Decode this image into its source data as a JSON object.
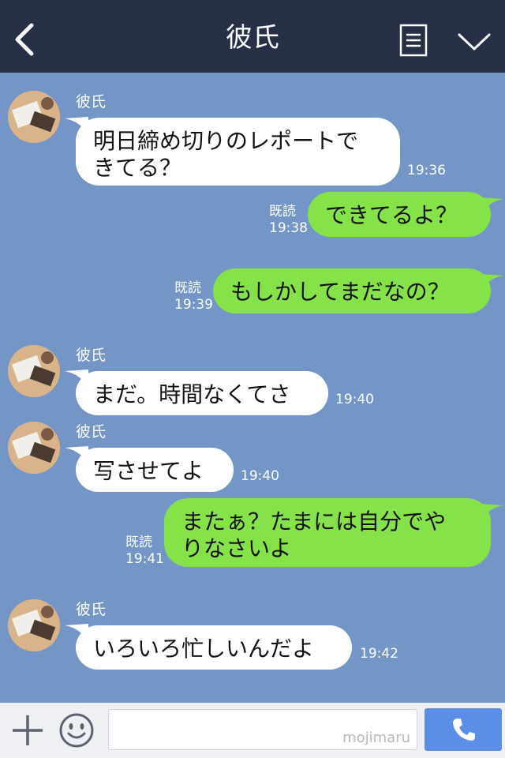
{
  "header": {
    "title": "彼氏"
  },
  "messages": [
    {
      "dir": "in",
      "sender": "彼氏",
      "line1": "明日締め切りのレポートで",
      "line2": "きてる？",
      "time": "19:36"
    },
    {
      "dir": "out",
      "read": "既読",
      "time": "19:38",
      "text": "できてるよ？"
    },
    {
      "dir": "out",
      "read": "既読",
      "time": "19:39",
      "text": "もしかしてまだなの？"
    },
    {
      "dir": "in",
      "sender": "彼氏",
      "text": "まだ。時間なくてさ",
      "time": "19:40"
    },
    {
      "dir": "in",
      "sender": "彼氏",
      "text": "写させてよ",
      "time": "19:40"
    },
    {
      "dir": "out",
      "read": "既読",
      "time": "19:41",
      "line1": "またぁ？たまには自分でや",
      "line2": "りなさいよ"
    },
    {
      "dir": "in",
      "sender": "彼氏",
      "text": "いろいろ忙しいんだよ",
      "time": "19:42"
    }
  ],
  "footer": {
    "watermark": "mojimaru"
  },
  "colors": {
    "header": "#262f45",
    "chat_bg": "#7396c6",
    "out_bubble": "#85e249",
    "in_bubble": "#ffffff",
    "call_button": "#5b8ee6"
  },
  "icons": {
    "back": "chevron-left-icon",
    "menu": "list-icon",
    "collapse": "chevron-down-icon",
    "add": "plus-icon",
    "sticker": "smiley-icon",
    "call": "phone-icon"
  }
}
